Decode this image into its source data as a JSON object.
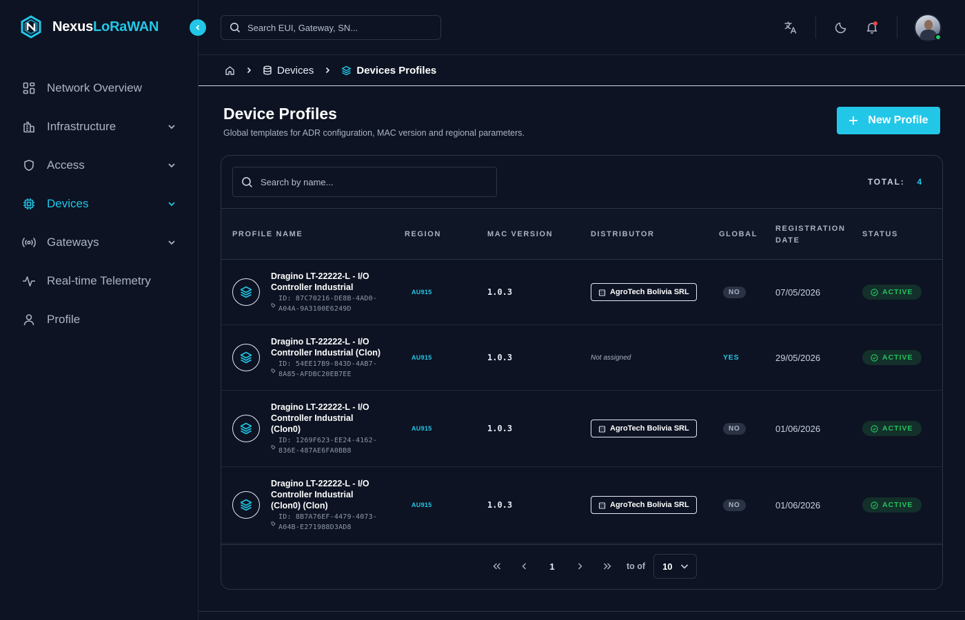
{
  "brand": {
    "name_white": "Nexus",
    "name_cyan": "LoRaWAN"
  },
  "colors": {
    "accent": "#22c7e8",
    "background": "#0d1322",
    "success": "#22c55e",
    "border": "#2b3548"
  },
  "sidebar": {
    "items": [
      {
        "label": "Network Overview",
        "icon": "grid-icon",
        "has_chevron": false,
        "active": false
      },
      {
        "label": "Infrastructure",
        "icon": "building-icon",
        "has_chevron": true,
        "active": false
      },
      {
        "label": "Access",
        "icon": "shield-icon",
        "has_chevron": true,
        "active": false
      },
      {
        "label": "Devices",
        "icon": "chip-icon",
        "has_chevron": true,
        "active": true
      },
      {
        "label": "Gateways",
        "icon": "broadcast-icon",
        "has_chevron": true,
        "active": false
      },
      {
        "label": "Real-time Telemetry",
        "icon": "activity-icon",
        "has_chevron": false,
        "active": false
      },
      {
        "label": "Profile",
        "icon": "user-icon",
        "has_chevron": false,
        "active": false
      }
    ]
  },
  "topbar": {
    "search_placeholder": "Search EUI, Gateway, SN...",
    "icons": [
      "translate-icon",
      "moon-icon",
      "bell-icon"
    ]
  },
  "breadcrumb": {
    "items": [
      {
        "label": "Devices",
        "icon": "database-icon"
      },
      {
        "label": "Devices Profiles",
        "icon": "layers-icon"
      }
    ]
  },
  "page": {
    "title": "Device Profiles",
    "subtitle": "Global templates for ADR configuration, MAC version and regional parameters.",
    "new_button": "New Profile"
  },
  "table": {
    "search_placeholder": "Search by name...",
    "total_label": "TOTAL:",
    "total_value": "4",
    "columns": {
      "name": "PROFILE NAME",
      "region": "REGION",
      "mac": "MAC VERSION",
      "distributor": "DISTRIBUTOR",
      "global": "GLOBAL",
      "reg_date_1": "REGISTRATION",
      "reg_date_2": "DATE",
      "status": "STATUS"
    },
    "rows": [
      {
        "name": "Dragino LT-22222-L - I/O Controller Industrial",
        "id": "ID: 87C70216-DE8B-4AD0-A04A-9A3100E6249D",
        "region": "AU915",
        "mac": "1.0.3",
        "distributor": "AgroTech Bolivia SRL",
        "global": "NO",
        "date": "07/05/2026",
        "status": "ACTIVE"
      },
      {
        "name": "Dragino LT-22222-L - I/O Controller Industrial (Clon)",
        "id": "ID: 54EE17B9-843D-4AB7-8A85-AFDBC20EB7EE",
        "region": "AU915",
        "mac": "1.0.3",
        "distributor": "Not assigned",
        "global": "YES",
        "date": "29/05/2026",
        "status": "ACTIVE"
      },
      {
        "name": "Dragino LT-22222-L - I/O Controller Industrial (Clon0)",
        "id": "ID: 1269F623-EE24-4162-836E-487AE6FA0BB8",
        "region": "AU915",
        "mac": "1.0.3",
        "distributor": "AgroTech Bolivia SRL",
        "global": "NO",
        "date": "01/06/2026",
        "status": "ACTIVE"
      },
      {
        "name": "Dragino LT-22222-L - I/O Controller Industrial (Clon0) (Clon)",
        "id": "ID: 8B7A76EF-4479-4073-A04B-E271988D3AD8",
        "region": "AU915",
        "mac": "1.0.3",
        "distributor": "AgroTech Bolivia SRL",
        "global": "NO",
        "date": "01/06/2026",
        "status": "ACTIVE"
      }
    ]
  },
  "pagination": {
    "current_page": "1",
    "to_of_label": "to of",
    "page_size": "10"
  }
}
